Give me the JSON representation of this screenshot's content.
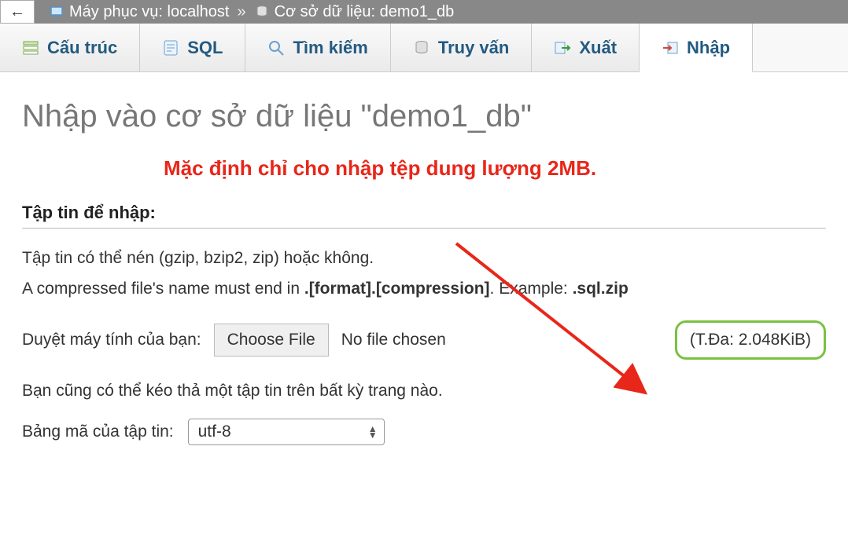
{
  "breadcrumb": {
    "back_arrow": "←",
    "server_label": "Máy phục vụ: localhost",
    "separator": "»",
    "db_label": "Cơ sở dữ liệu: demo1_db"
  },
  "tabs": {
    "structure": "Cấu trúc",
    "sql": "SQL",
    "search": "Tìm kiếm",
    "query": "Truy vấn",
    "export": "Xuất",
    "import": "Nhập"
  },
  "page_title": "Nhập vào cơ sở dữ liệu \"demo1_db\"",
  "annotation_text": "Mặc định chỉ cho nhập tệp dung lượng 2MB.",
  "section_title": "Tập tin để nhập:",
  "file_hint_1": "Tập tin có thể nén (gzip, bzip2, zip) hoặc không.",
  "file_hint_2_pre": "A compressed file's name must end in ",
  "file_hint_2_bold1": ".[format].[compression]",
  "file_hint_2_mid": ". Example: ",
  "file_hint_2_bold2": ".sql.zip",
  "browse_label": "Duyệt máy tính của bạn:",
  "choose_file_btn": "Choose File",
  "no_file_text": "No file chosen",
  "max_size": "(T.Đa: 2.048KiB)",
  "dragdrop_hint": "Bạn cũng có thể kéo thả một tập tin trên bất kỳ trang nào.",
  "charset_label": "Bảng mã của tập tin:",
  "charset_value": "utf-8"
}
